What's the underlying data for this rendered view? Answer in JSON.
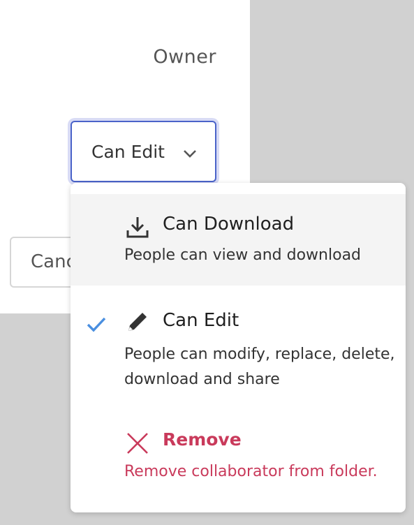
{
  "share_panel": {
    "owner_label": "Owner",
    "permission_select": {
      "selected_value": "Can Edit",
      "icon": "chevron-down-icon"
    },
    "cancel_label": "Canc"
  },
  "permission_menu": {
    "options": [
      {
        "title": "Can Download",
        "description": "People can view and download",
        "icon": "download-icon",
        "highlighted": true,
        "selected": false
      },
      {
        "title": "Can Edit",
        "description": "People can modify, replace, delete, download and share",
        "icon": "pencil-icon",
        "highlighted": false,
        "selected": true
      },
      {
        "title": "Remove",
        "description": "Remove collaborator from folder.",
        "icon": "x-icon",
        "highlighted": false,
        "selected": false
      }
    ]
  },
  "colors": {
    "accent_blue": "#4a63c9",
    "check_blue": "#4a8fe0",
    "danger_red": "#c93a5b",
    "backdrop": "#d1d1d1",
    "hover_bg": "#f4f4f4"
  }
}
